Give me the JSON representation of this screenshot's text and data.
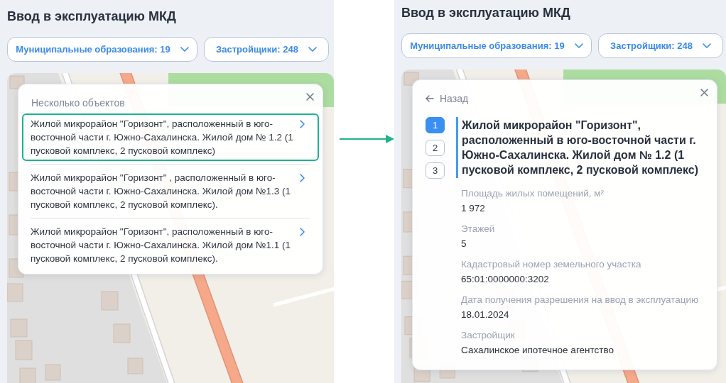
{
  "screens": [
    {
      "title": "Ввод в эксплуатацию МКД",
      "filters": [
        {
          "label": "Муниципальные образования: 19"
        },
        {
          "label": "Застройщики: 248"
        }
      ],
      "popup": {
        "kind": "list",
        "heading": "Несколько объектов",
        "items": [
          {
            "text": "Жилой микрорайон \"Горизонт\", расположенный в юго-восточной части г. Южно-Сахалинска. Жилой дом № 1.2 (1 пусковой комплекс, 2 пусковой комплекс)",
            "selected": true
          },
          {
            "text": "Жилой микрорайон \"Горизонт\" , расположенный в юго-восточной части г. Южно-Сахалинска. Жилой дом №1.3 (1 пусковой комплекс, 2 пусковой комплекс).",
            "selected": false
          },
          {
            "text": "Жилой микрорайон \"Горизонт\", расположенный в юго-восточной части г. Южно-Сахалинска. Жилой дом №1.1 (1 пусковой комплекс, 2 пусковой комплекс).",
            "selected": false
          }
        ]
      }
    },
    {
      "title": "Ввод в эксплуатацию МКД",
      "filters": [
        {
          "label": "Муниципальные образования: 19"
        },
        {
          "label": "Застройщики: 248"
        }
      ],
      "popup": {
        "kind": "details",
        "back": "Назад",
        "tabs": [
          {
            "label": "1",
            "selected": true
          },
          {
            "label": "2",
            "selected": false
          },
          {
            "label": "3",
            "selected": false
          }
        ],
        "heading": "Жилой микрорайон \"Горизонт\", расположенный в юго-восточной части г. Южно-Сахалинска. Жилой дом № 1.2 (1 пусковой комплекс, 2 пусковой комплекс)",
        "fields": [
          {
            "label": "Площадь жилых помещений, м²",
            "value": "1 972"
          },
          {
            "label": "Этажей",
            "value": "5"
          },
          {
            "label": "Кадастровый номер земельного участка",
            "value": "65:01:0000000:3202"
          },
          {
            "label": "Дата получения разрешения на ввод в эксплуатацию",
            "value": "18.01.2024"
          },
          {
            "label": "Застройщик",
            "value": "Сахалинское ипотечное агентство"
          }
        ]
      }
    }
  ]
}
